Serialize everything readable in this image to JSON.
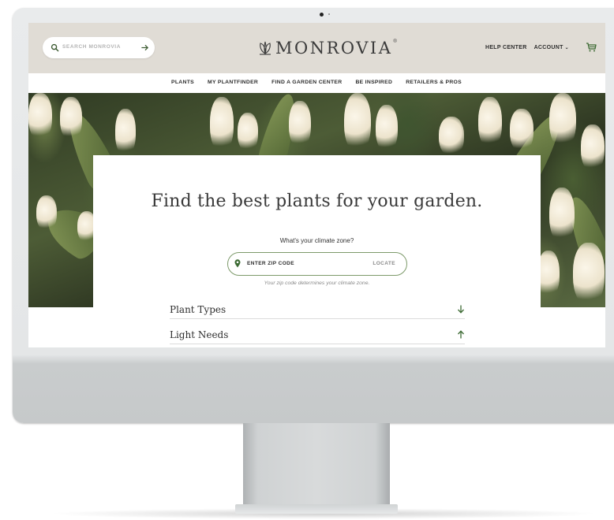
{
  "search": {
    "placeholder": "SEARCH MONROVIA"
  },
  "brand": {
    "name": "MONROVIA",
    "reg": "®"
  },
  "header_links": [
    {
      "label": "HELP CENTER"
    },
    {
      "label": "ACCOUNT",
      "chevron": "⌄"
    }
  ],
  "nav": [
    "PLANTS",
    "MY PLANTFINDER",
    "FIND A GARDEN CENTER",
    "BE INSPIRED",
    "RETAILERS & PROS"
  ],
  "hero": {
    "title": "Find the best plants for your garden.",
    "climate_question": "What's your climate zone?",
    "zip_placeholder": "ENTER ZIP CODE",
    "locate_label": "LOCATE",
    "zip_note": "Your zip code determines your climate zone."
  },
  "filters": [
    {
      "label": "Plant Types",
      "icon": "arrow-down-icon"
    },
    {
      "label": "Light Needs",
      "icon": "arrow-up-icon"
    }
  ],
  "colors": {
    "header_bg": "#e0dcd5",
    "accent_green": "#4c7a3c",
    "text_dark": "#3a3a3a"
  }
}
